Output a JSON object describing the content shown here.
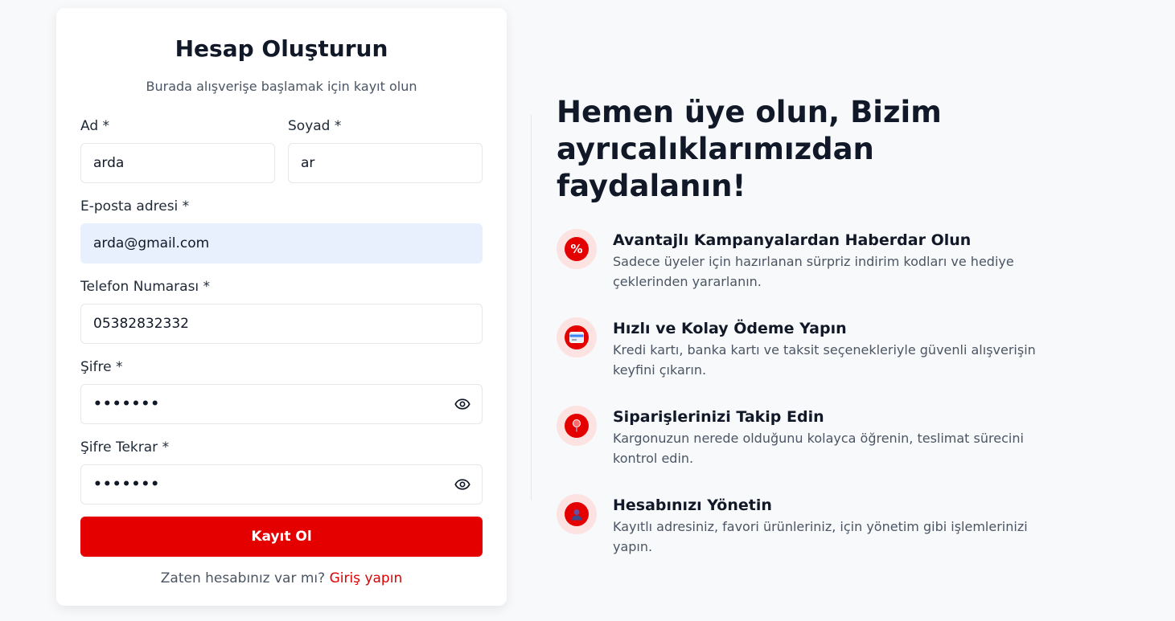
{
  "form": {
    "title": "Hesap Oluşturun",
    "subtitle": "Burada alışverişe başlamak için kayıt olun",
    "first_name": {
      "label": "Ad *",
      "value": "arda"
    },
    "last_name": {
      "label": "Soyad *",
      "value": "ar"
    },
    "email": {
      "label": "E-posta adresi *",
      "value": "arda@gmail.com"
    },
    "phone": {
      "label": "Telefon Numarası *",
      "value": "05382832332"
    },
    "password": {
      "label": "Şifre *",
      "value": "•••••••"
    },
    "password_confirm": {
      "label": "Şifre Tekrar *",
      "value": "•••••••"
    },
    "submit_label": "Kayıt Ol",
    "login_prompt": "Zaten hesabınız var mı?",
    "login_link": "Giriş yapın"
  },
  "promo": {
    "headline_line1": "Hemen üye olun, Bizim",
    "headline_line2": "ayrıcalıklarımızdan faydalanın!",
    "features": [
      {
        "icon": "percent-icon",
        "title": "Avantajlı Kampanyalardan Haberdar Olun",
        "description": "Sadece üyeler için hazırlanan sürpriz indirim kodları ve hediye çeklerinden yararlanın."
      },
      {
        "icon": "credit-card-icon",
        "title": "Hızlı ve Kolay Ödeme Yapın",
        "description": "Kredi kartı, banka kartı ve taksit seçenekleriyle güvenli alışverişin keyfini çıkarın."
      },
      {
        "icon": "location-pin-icon",
        "title": "Siparişlerinizi Takip Edin",
        "description": "Kargonuzun nerede olduğunu kolayca öğrenin, teslimat sürecini kontrol edin."
      },
      {
        "icon": "user-icon",
        "title": "Hesabınızı Yönetin",
        "description": "Kayıtlı adresiniz, favori ürünleriniz, için yönetim gibi işlemlerinizi yapın."
      }
    ]
  },
  "colors": {
    "accent": "#e50000",
    "accent_light": "#fde2e2",
    "autofill_bg": "#e8effd"
  }
}
